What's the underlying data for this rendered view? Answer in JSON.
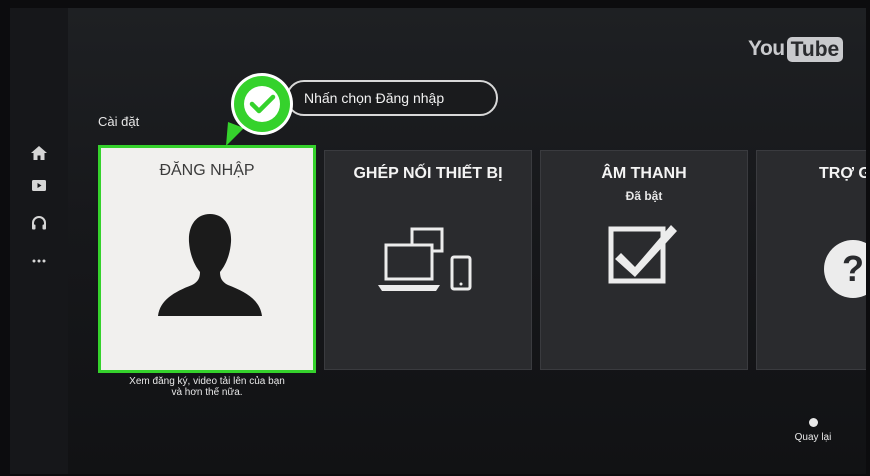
{
  "brand": {
    "logo_you": "You",
    "logo_tube": "Tube"
  },
  "sidebar": {
    "items": [
      {
        "icon": "home-icon"
      },
      {
        "icon": "subscriptions-icon"
      },
      {
        "icon": "headphones-icon"
      },
      {
        "icon": "more-icon"
      }
    ]
  },
  "section_title": "Cài đặt",
  "callout": {
    "text": "Nhấn chọn Đăng nhập",
    "color": "#35d22c"
  },
  "tiles": [
    {
      "title": "ĐĂNG NHẬP",
      "icon": "user-silhouette-icon",
      "selected": true,
      "caption_line1": "Xem đăng ký, video tải lên của bạn",
      "caption_line2": "và hơn thế nữa."
    },
    {
      "title": "GHÉP NỐI THIẾT BỊ",
      "icon": "devices-icon"
    },
    {
      "title": "ÂM THANH",
      "subtitle": "Đã bật",
      "icon": "checkbox-checked-icon"
    },
    {
      "title": "TRỢ G",
      "icon": "help-icon"
    }
  ],
  "back": {
    "label": "Quay lại"
  },
  "colors": {
    "accent": "#35d22c",
    "tile_bg": "#2a2b2e",
    "selected_bg": "#f1f0ee"
  }
}
